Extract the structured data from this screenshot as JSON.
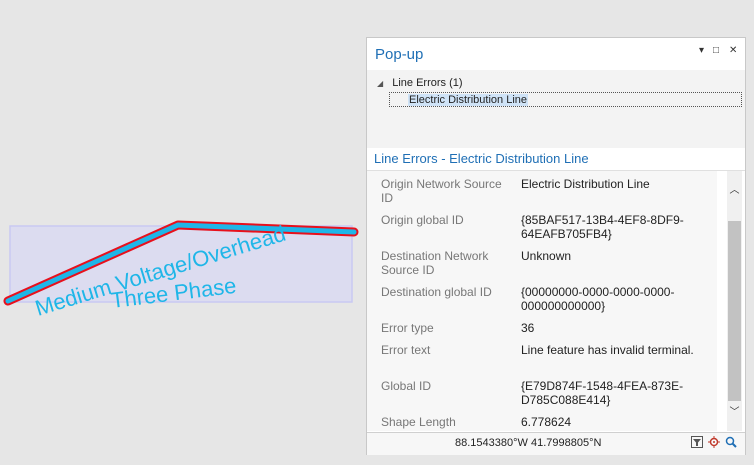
{
  "map": {
    "label_line1": "Medium Voltage/Overhead",
    "label_line2": "Three Phase",
    "colors": {
      "line_inner": "#1fb6e8",
      "line_outer": "#e8101c",
      "label": "#1fb6e8",
      "selection_box": "#c9c9f2"
    }
  },
  "popup": {
    "title": "Pop-up",
    "controls": {
      "pin": "▾",
      "maximize": "□",
      "close": "✕"
    },
    "tree": {
      "group_label": "Line Errors  (1)",
      "item_label": "Electric Distribution Line"
    },
    "section_title": "Line Errors - Electric Distribution Line",
    "fields": [
      {
        "key": "Origin Network Source ID",
        "value": "Electric Distribution Line"
      },
      {
        "key": "Origin global ID",
        "value": "{85BAF517-13B4-4EF8-8DF9-64EAFB705FB4}"
      },
      {
        "key": "Destination Network Source ID",
        "value": "Unknown"
      },
      {
        "key": "Destination global ID",
        "value": "{00000000-0000-0000-0000-000000000000}"
      },
      {
        "key": "Error type",
        "value": "36"
      },
      {
        "key": "Error text",
        "value": "Line feature has invalid terminal."
      },
      {
        "key": "Global ID",
        "value": "{E79D874F-1548-4FEA-873E-D785C088E414}"
      },
      {
        "key": "Shape Length",
        "value": "6.778624"
      }
    ],
    "status_coords": "88.1543380°W 41.7998805°N",
    "status_icons": [
      "filter-icon",
      "locate-icon",
      "zoom-icon"
    ]
  }
}
